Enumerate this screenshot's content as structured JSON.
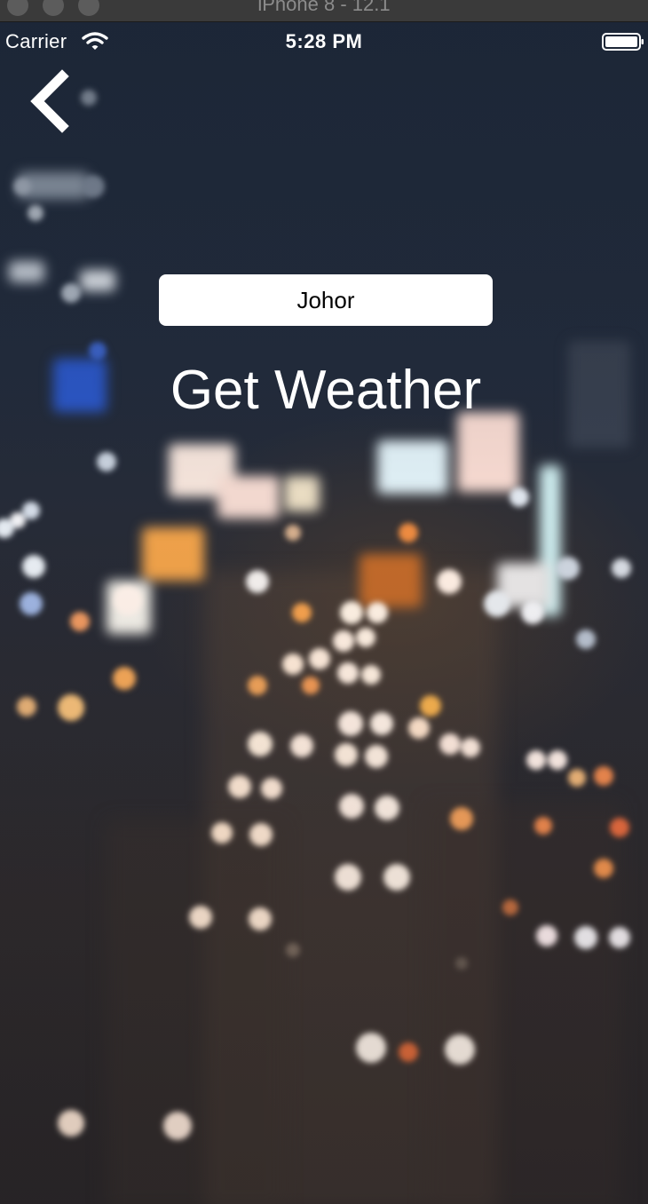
{
  "simulator": {
    "window_title": "iPhone 8 - 12.1"
  },
  "status_bar": {
    "carrier": "Carrier",
    "time": "5:28 PM",
    "icons": [
      "wifi-icon",
      "battery-icon"
    ]
  },
  "navigation": {
    "back_icon": "chevron-left-icon"
  },
  "city_input": {
    "value": "Johor"
  },
  "get_weather_button": {
    "label": "Get Weather"
  },
  "background": {
    "image": "blurred-night-city-traffic"
  },
  "colors": {
    "text": "#ffffff",
    "input_background": "#ffffff",
    "input_text": "#000000"
  }
}
